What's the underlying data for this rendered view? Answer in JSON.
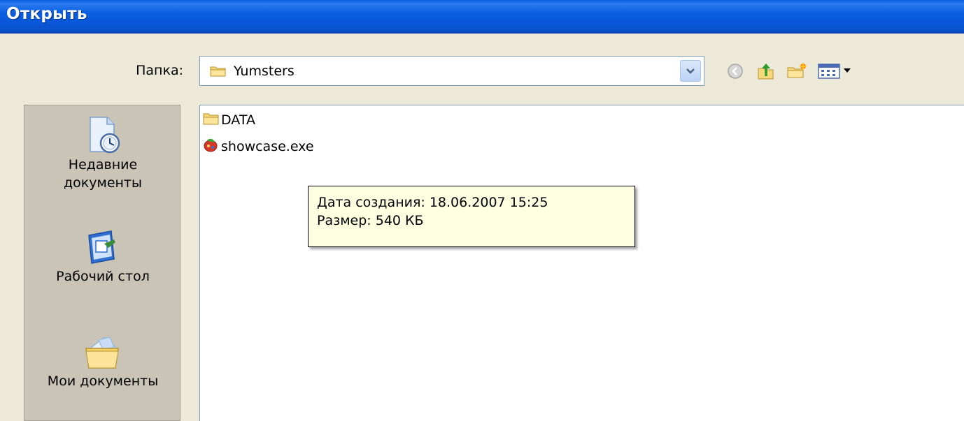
{
  "window": {
    "title": "Открыть"
  },
  "folder_bar": {
    "label": "Папка:",
    "current_folder": "Yumsters"
  },
  "toolbar": {
    "buttons": [
      "back-icon",
      "up-folder-icon",
      "new-folder-icon",
      "view-menu-icon"
    ]
  },
  "places": [
    {
      "label_line1": "Недавние",
      "label_line2": "документы",
      "icon": "recent-documents-icon"
    },
    {
      "label_line1": "Рабочий стол",
      "label_line2": "",
      "icon": "desktop-icon"
    },
    {
      "label_line1": "Мои документы",
      "label_line2": "",
      "icon": "my-documents-icon"
    }
  ],
  "files": [
    {
      "name": "DATA",
      "icon": "folder-icon"
    },
    {
      "name": "showcase.exe",
      "icon": "exe-icon"
    }
  ],
  "tooltip": {
    "created": "Дата создания: 18.06.2007 15:25",
    "size": "Размер: 540 КБ"
  },
  "colors": {
    "title_bar": "#0a5ddb",
    "dialog_bg": "#ece9d8",
    "places_bg": "#c9c4b5",
    "tooltip_bg": "#ffffe1"
  }
}
